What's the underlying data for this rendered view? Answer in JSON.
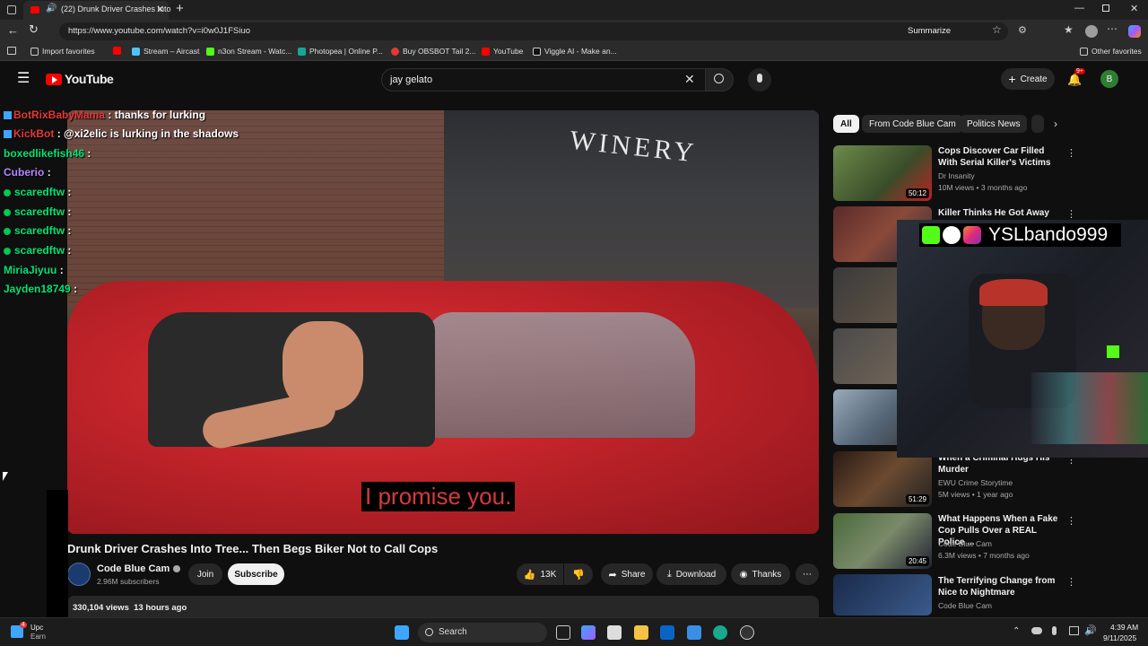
{
  "browser": {
    "tab_title": "(22) Drunk Driver Crashes Into",
    "url": "https://www.youtube.com/watch?v=i0w0J1FSiuo",
    "summarize_label": "Summarize",
    "bookmarks": [
      "Import favorites",
      "Stream – Aircast",
      "n3on Stream - Watc...",
      "Photopea | Online P...",
      "Buy OBSBOT Tail 2...",
      "YouTube",
      "Viggle AI - Make an..."
    ],
    "other_favorites": "Other favorites"
  },
  "youtube": {
    "logo_text": "YouTube",
    "search_query": "jay gelato",
    "create_label": "Create",
    "notif_badge": "9+",
    "account_initial": "B"
  },
  "chat": [
    {
      "user": "BotRixBabyMama",
      "msg": ": thanks for lurking",
      "user_color": "#e53935"
    },
    {
      "user": "KickBot",
      "msg": ": @xi2elic is lurking in the shadows",
      "user_color": "#e53935"
    },
    {
      "user": "boxedlikefish46",
      "msg": ":",
      "user_color": "#00e676"
    },
    {
      "user": "Cuberio",
      "msg": ":",
      "user_color": "#b388ff"
    },
    {
      "user": "scaredftw",
      "msg": ":",
      "user_color": "#00e676"
    },
    {
      "user": "scaredftw",
      "msg": ":",
      "user_color": "#00e676"
    },
    {
      "user": "scaredftw",
      "msg": ":",
      "user_color": "#00e676"
    },
    {
      "user": "scaredftw",
      "msg": ":",
      "user_color": "#00e676"
    },
    {
      "user": "MiriaJiyuu",
      "msg": ":",
      "user_color": "#00e676"
    },
    {
      "user": "Jayden18749",
      "msg": ":",
      "user_color": "#00e676"
    }
  ],
  "video": {
    "caption": "I promise you.",
    "winery_sign": "WINERY",
    "title": "Drunk Driver Crashes Into Tree... Then Begs Biker Not to Call Cops",
    "channel": "Code Blue Cam",
    "subscribers": "2.96M subscribers",
    "join": "Join",
    "subscribe": "Subscribe",
    "likes": "13K",
    "share": "Share",
    "download": "Download",
    "thanks": "Thanks",
    "views_line": "330,104 views  13 hours ago"
  },
  "chips": [
    "All",
    "From Code Blue Cam",
    "Politics News"
  ],
  "related": [
    {
      "title": "Cops Discover Car Filled With Serial Killer's Victims",
      "channel": "Dr Insanity",
      "meta": "10M views • 3 months ago",
      "duration": "50:12"
    },
    {
      "title": "Killer Thinks He Got Away Until",
      "channel": "",
      "meta": "",
      "duration": ""
    },
    {
      "title": "When a Criminal Hugs His Murder",
      "channel": "EWU Crime Storytime",
      "meta": "5M views • 1 year ago",
      "duration": "51:29"
    },
    {
      "title": "What Happens When a Fake Cop Pulls Over a REAL Police ...",
      "channel": "Code Blue Cam",
      "meta": "6.3M views • 7 months ago",
      "duration": "20:45"
    },
    {
      "title": "The Terrifying Change from Nice to Nightmare",
      "channel": "Code Blue Cam",
      "meta": "",
      "duration": ""
    }
  ],
  "webcam": {
    "streamer_name": "YSLbando999"
  },
  "taskbar": {
    "search_label": "Search",
    "time": "4:39 AM",
    "date": "9/11/2025",
    "weather_text": "Upc",
    "weather_sub": "Earn",
    "notif_count": "4"
  }
}
